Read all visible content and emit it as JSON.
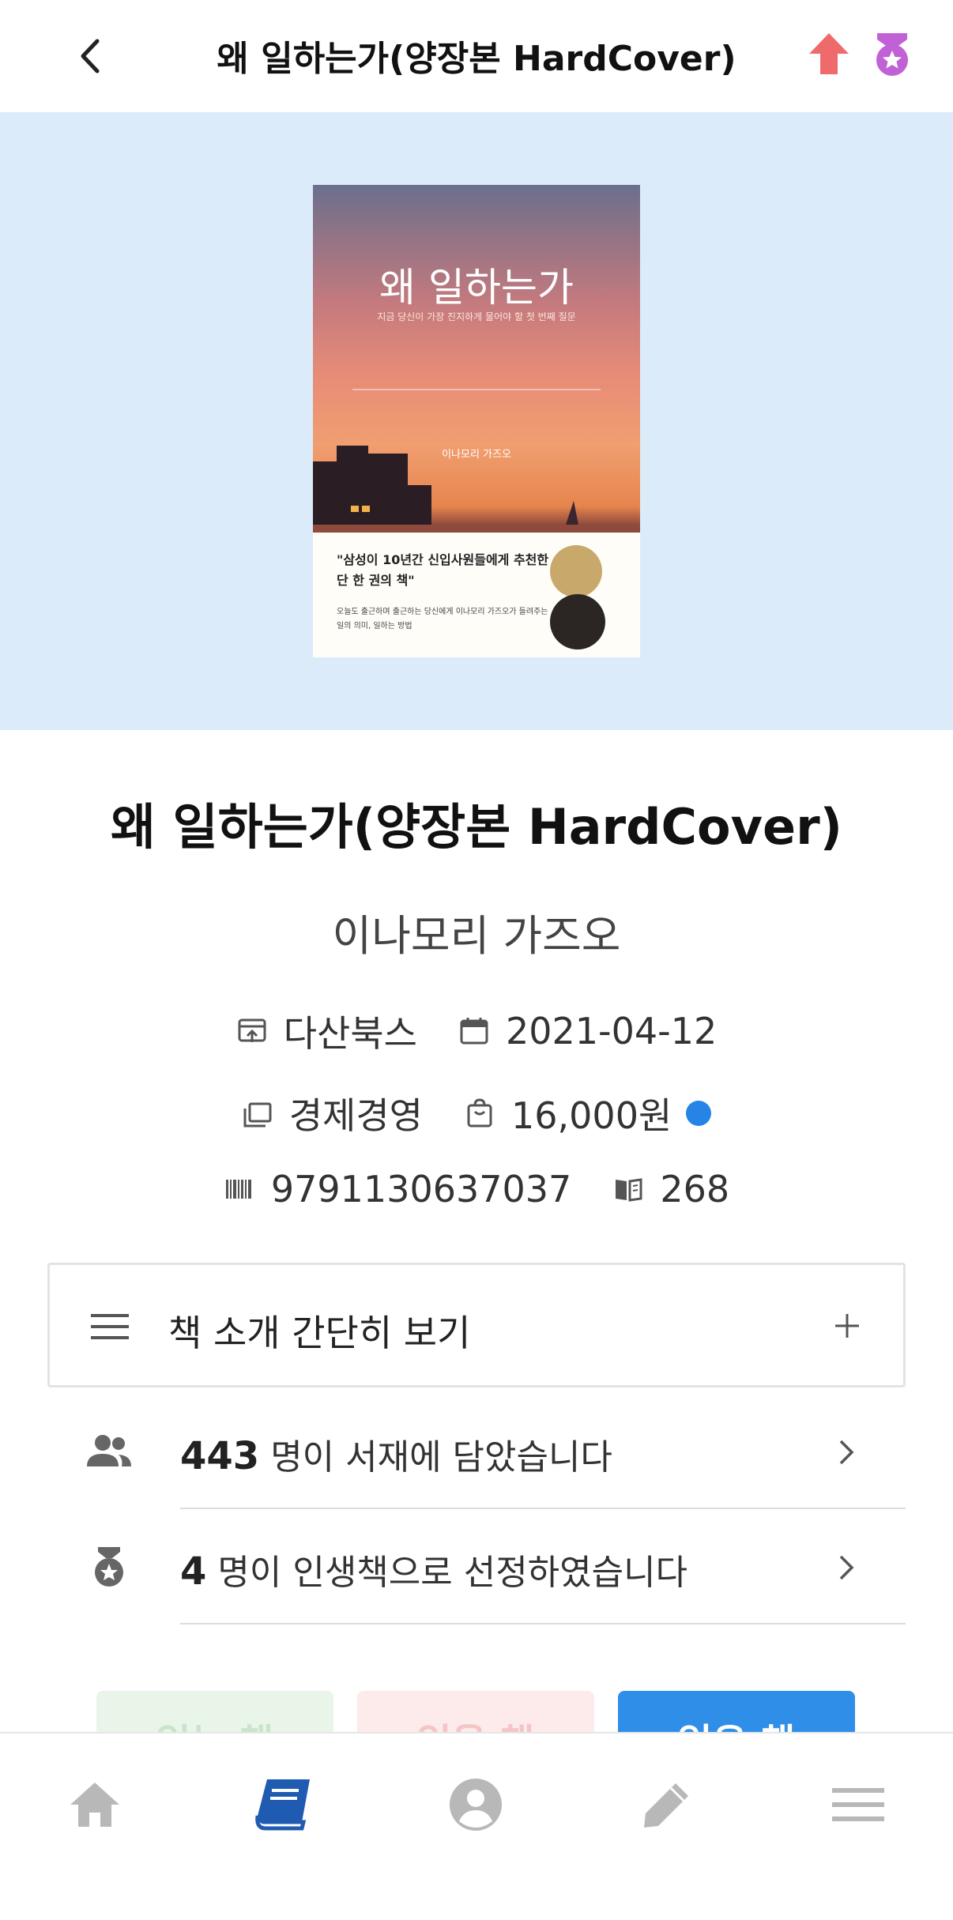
{
  "header": {
    "title": "왜 일하는가(양장본 HardCover)"
  },
  "cover": {
    "title": "왜 일하는가",
    "subtitle": "지금 당신이 가장 진지하게 물어야 할 첫 번째 질문",
    "author": "이나모리 가즈오",
    "quote": "\"삼성이 10년간 신입사원들에게 추천한 단 한 권의 책\"",
    "note": "오늘도 출근하며 출근하는 당신에게 이나모리 가즈오가 들려주는 일의 의미, 일하는 방법"
  },
  "book": {
    "title": "왜 일하는가(양장본 HardCover)",
    "author": "이나모리 가즈오",
    "publisher": "다산북스",
    "date": "2021-04-12",
    "category": "경제경영",
    "price": "16,000원",
    "isbn": "9791130637037",
    "pages": "268"
  },
  "accordion": {
    "label": "책 소개 간단히 보기"
  },
  "stats": {
    "shelf_count": "443",
    "shelf_text": " 명이 서재에 담았습니다",
    "life_count": "4",
    "life_text": " 명이 인생책으로 선정하였습니다"
  },
  "status_buttons": {
    "reading": "읽는 책",
    "want": "읽을 책",
    "read": "읽은 책"
  },
  "colors": {
    "accent_blue": "#2f8fe8",
    "cover_bg": "#dcebf9",
    "share_red": "#ef6b6b",
    "medal_purple": "#c062d6",
    "nav_active": "#1f5bb0",
    "nav_inactive": "#b8b8b8"
  },
  "icons": {
    "publisher": "publisher-icon",
    "date": "calendar-icon",
    "category": "category-icon",
    "price": "price-icon",
    "isbn": "barcode-icon",
    "pages": "pages-icon"
  }
}
